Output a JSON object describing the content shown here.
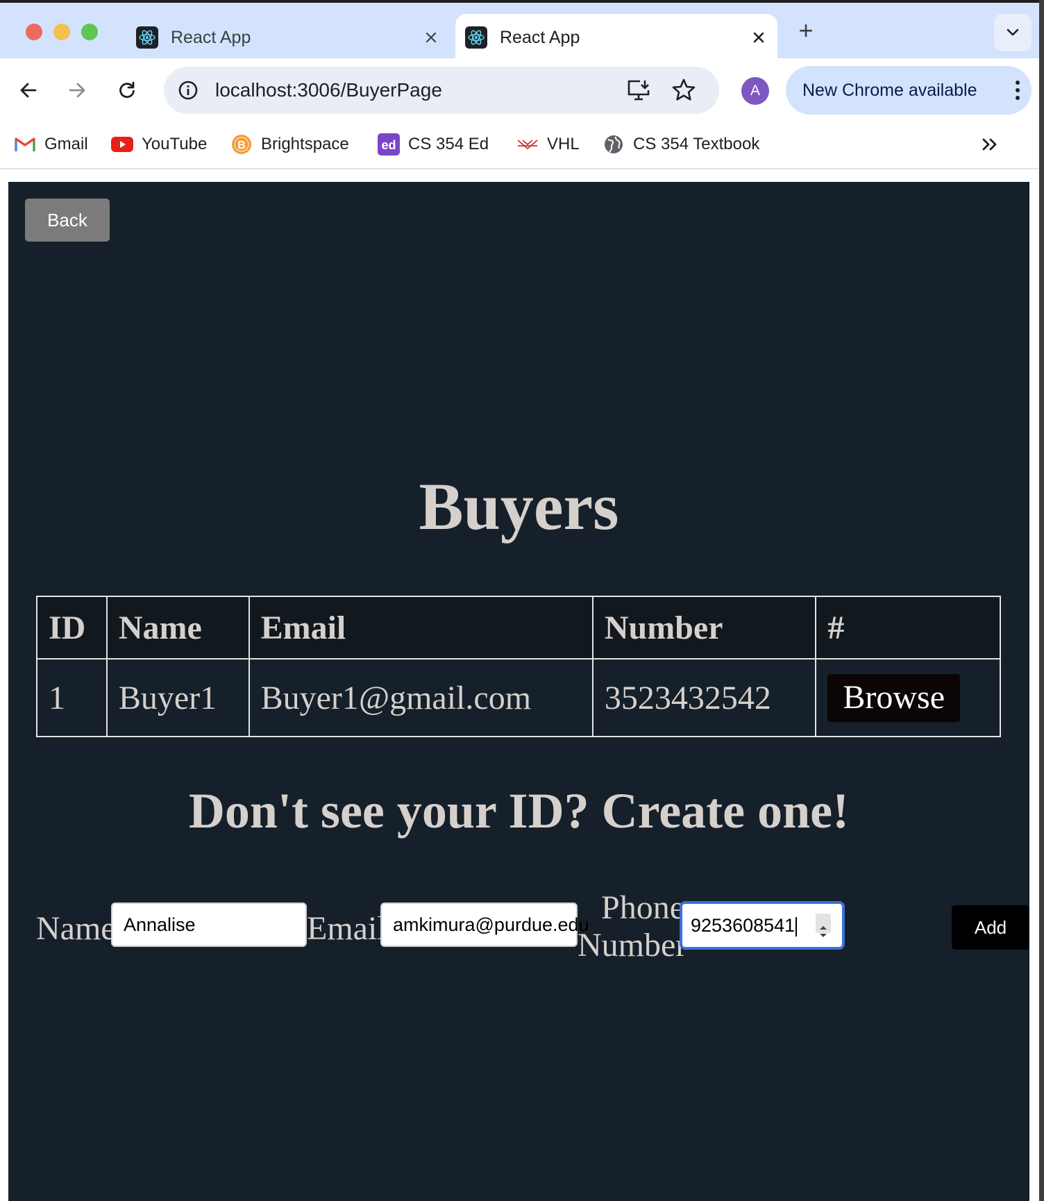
{
  "browser": {
    "tabs": [
      {
        "title": "React App",
        "active": false
      },
      {
        "title": "React App",
        "active": true
      }
    ],
    "new_tab_label": "+",
    "url": "localhost:3006/BuyerPage",
    "avatar_initial": "A",
    "update_button_label": "New Chrome available",
    "bookmarks": [
      {
        "label": "Gmail",
        "icon": "gmail-icon"
      },
      {
        "label": "YouTube",
        "icon": "youtube-icon"
      },
      {
        "label": "Brightspace",
        "icon": "brightspace-icon"
      },
      {
        "label": "CS 354 Ed",
        "icon": "ed-icon"
      },
      {
        "label": "VHL",
        "icon": "vhl-icon"
      },
      {
        "label": "CS 354 Textbook",
        "icon": "globe-icon"
      }
    ],
    "colors": {
      "tabstrip": "#d3e3fd",
      "omnibox": "#e9eef6",
      "update_pill": "#d3e3fd",
      "avatar": "#7e57c2"
    }
  },
  "page": {
    "back_label": "Back",
    "title": "Buyers",
    "table": {
      "headers": [
        "ID",
        "Name",
        "Email",
        "Number",
        "#"
      ],
      "rows": [
        {
          "id": "1",
          "name": "Buyer1",
          "email": "Buyer1@gmail.com",
          "number": "3523432542",
          "action_label": "Browse"
        }
      ]
    },
    "create_title": "Don't see your ID? Create one!",
    "form": {
      "name_label": "Name",
      "name_value": "Annalise",
      "email_label": "Email",
      "email_value": "amkimura@purdue.edu",
      "phone_label_line1": "Phone",
      "phone_label_line2": "Number",
      "phone_value": "9253608541",
      "add_label": "Add"
    },
    "colors": {
      "background": "#15202a",
      "text": "#d6d0cc",
      "back_button": "#7b7b7b",
      "focus_ring": "#3c6fd8"
    }
  }
}
